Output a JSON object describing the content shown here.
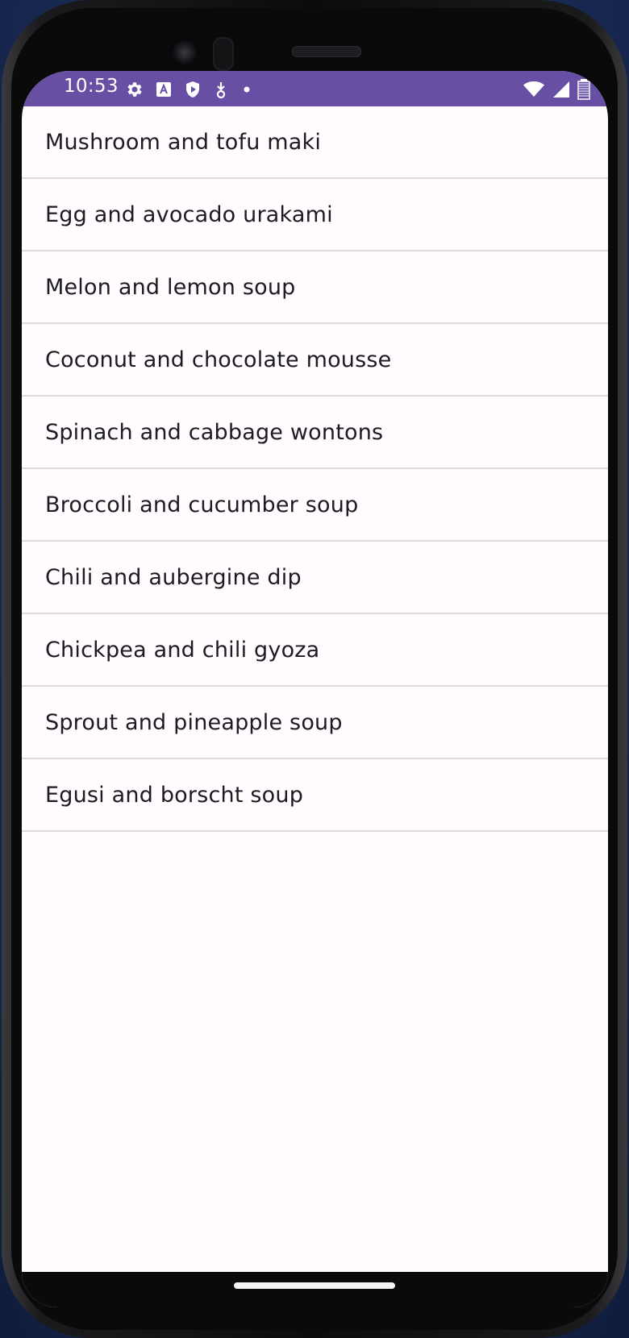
{
  "status_bar": {
    "time": "10:53",
    "left_icons": [
      "settings-icon",
      "text-a-icon",
      "shield-icon",
      "download-icon",
      "dot-icon"
    ],
    "right_icons": [
      "wifi-icon",
      "cellular-signal-icon",
      "battery-icon"
    ],
    "color": "#6750a4"
  },
  "recipes": [
    {
      "label": "Mushroom and tofu maki"
    },
    {
      "label": "Egg and avocado urakami"
    },
    {
      "label": "Melon and lemon soup"
    },
    {
      "label": "Coconut and chocolate mousse"
    },
    {
      "label": "Spinach and cabbage wontons"
    },
    {
      "label": "Broccoli and cucumber soup"
    },
    {
      "label": "Chili and aubergine dip"
    },
    {
      "label": "Chickpea and chili gyoza"
    },
    {
      "label": "Sprout and pineapple soup"
    },
    {
      "label": "Egusi and borscht soup"
    }
  ],
  "colors": {
    "background": "#fffbfe",
    "divider": "#dcdcdc",
    "text": "#1c1b1f"
  }
}
